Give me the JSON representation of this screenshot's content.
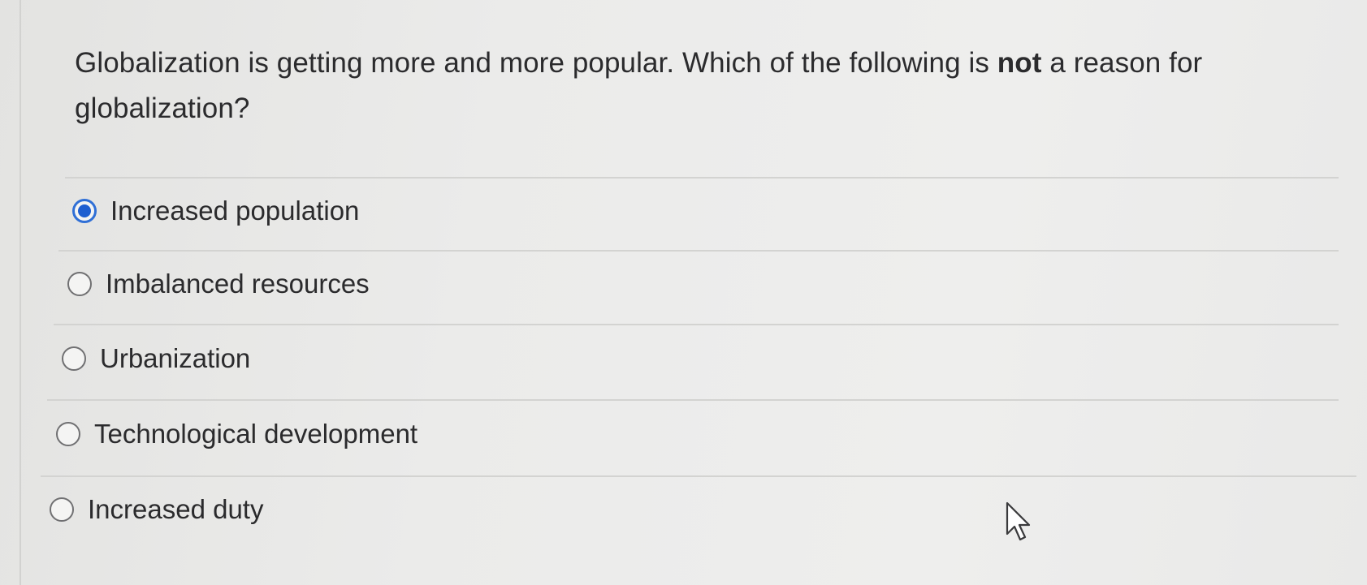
{
  "question": {
    "text_before": "Globalization is getting more and more popular. Which of the following is ",
    "emphasis": "not",
    "text_after": " a reason for globalization?"
  },
  "options": [
    {
      "label": "Increased population",
      "selected": true
    },
    {
      "label": "Imbalanced resources",
      "selected": false
    },
    {
      "label": "Urbanization",
      "selected": false
    },
    {
      "label": "Technological development",
      "selected": false
    },
    {
      "label": "Increased duty",
      "selected": false
    }
  ],
  "colors": {
    "selected_radio": "#1f5fd0",
    "text": "#2b2b2d",
    "divider": "#d3d3d1"
  },
  "icons": {
    "cursor": "mouse-pointer-icon"
  }
}
